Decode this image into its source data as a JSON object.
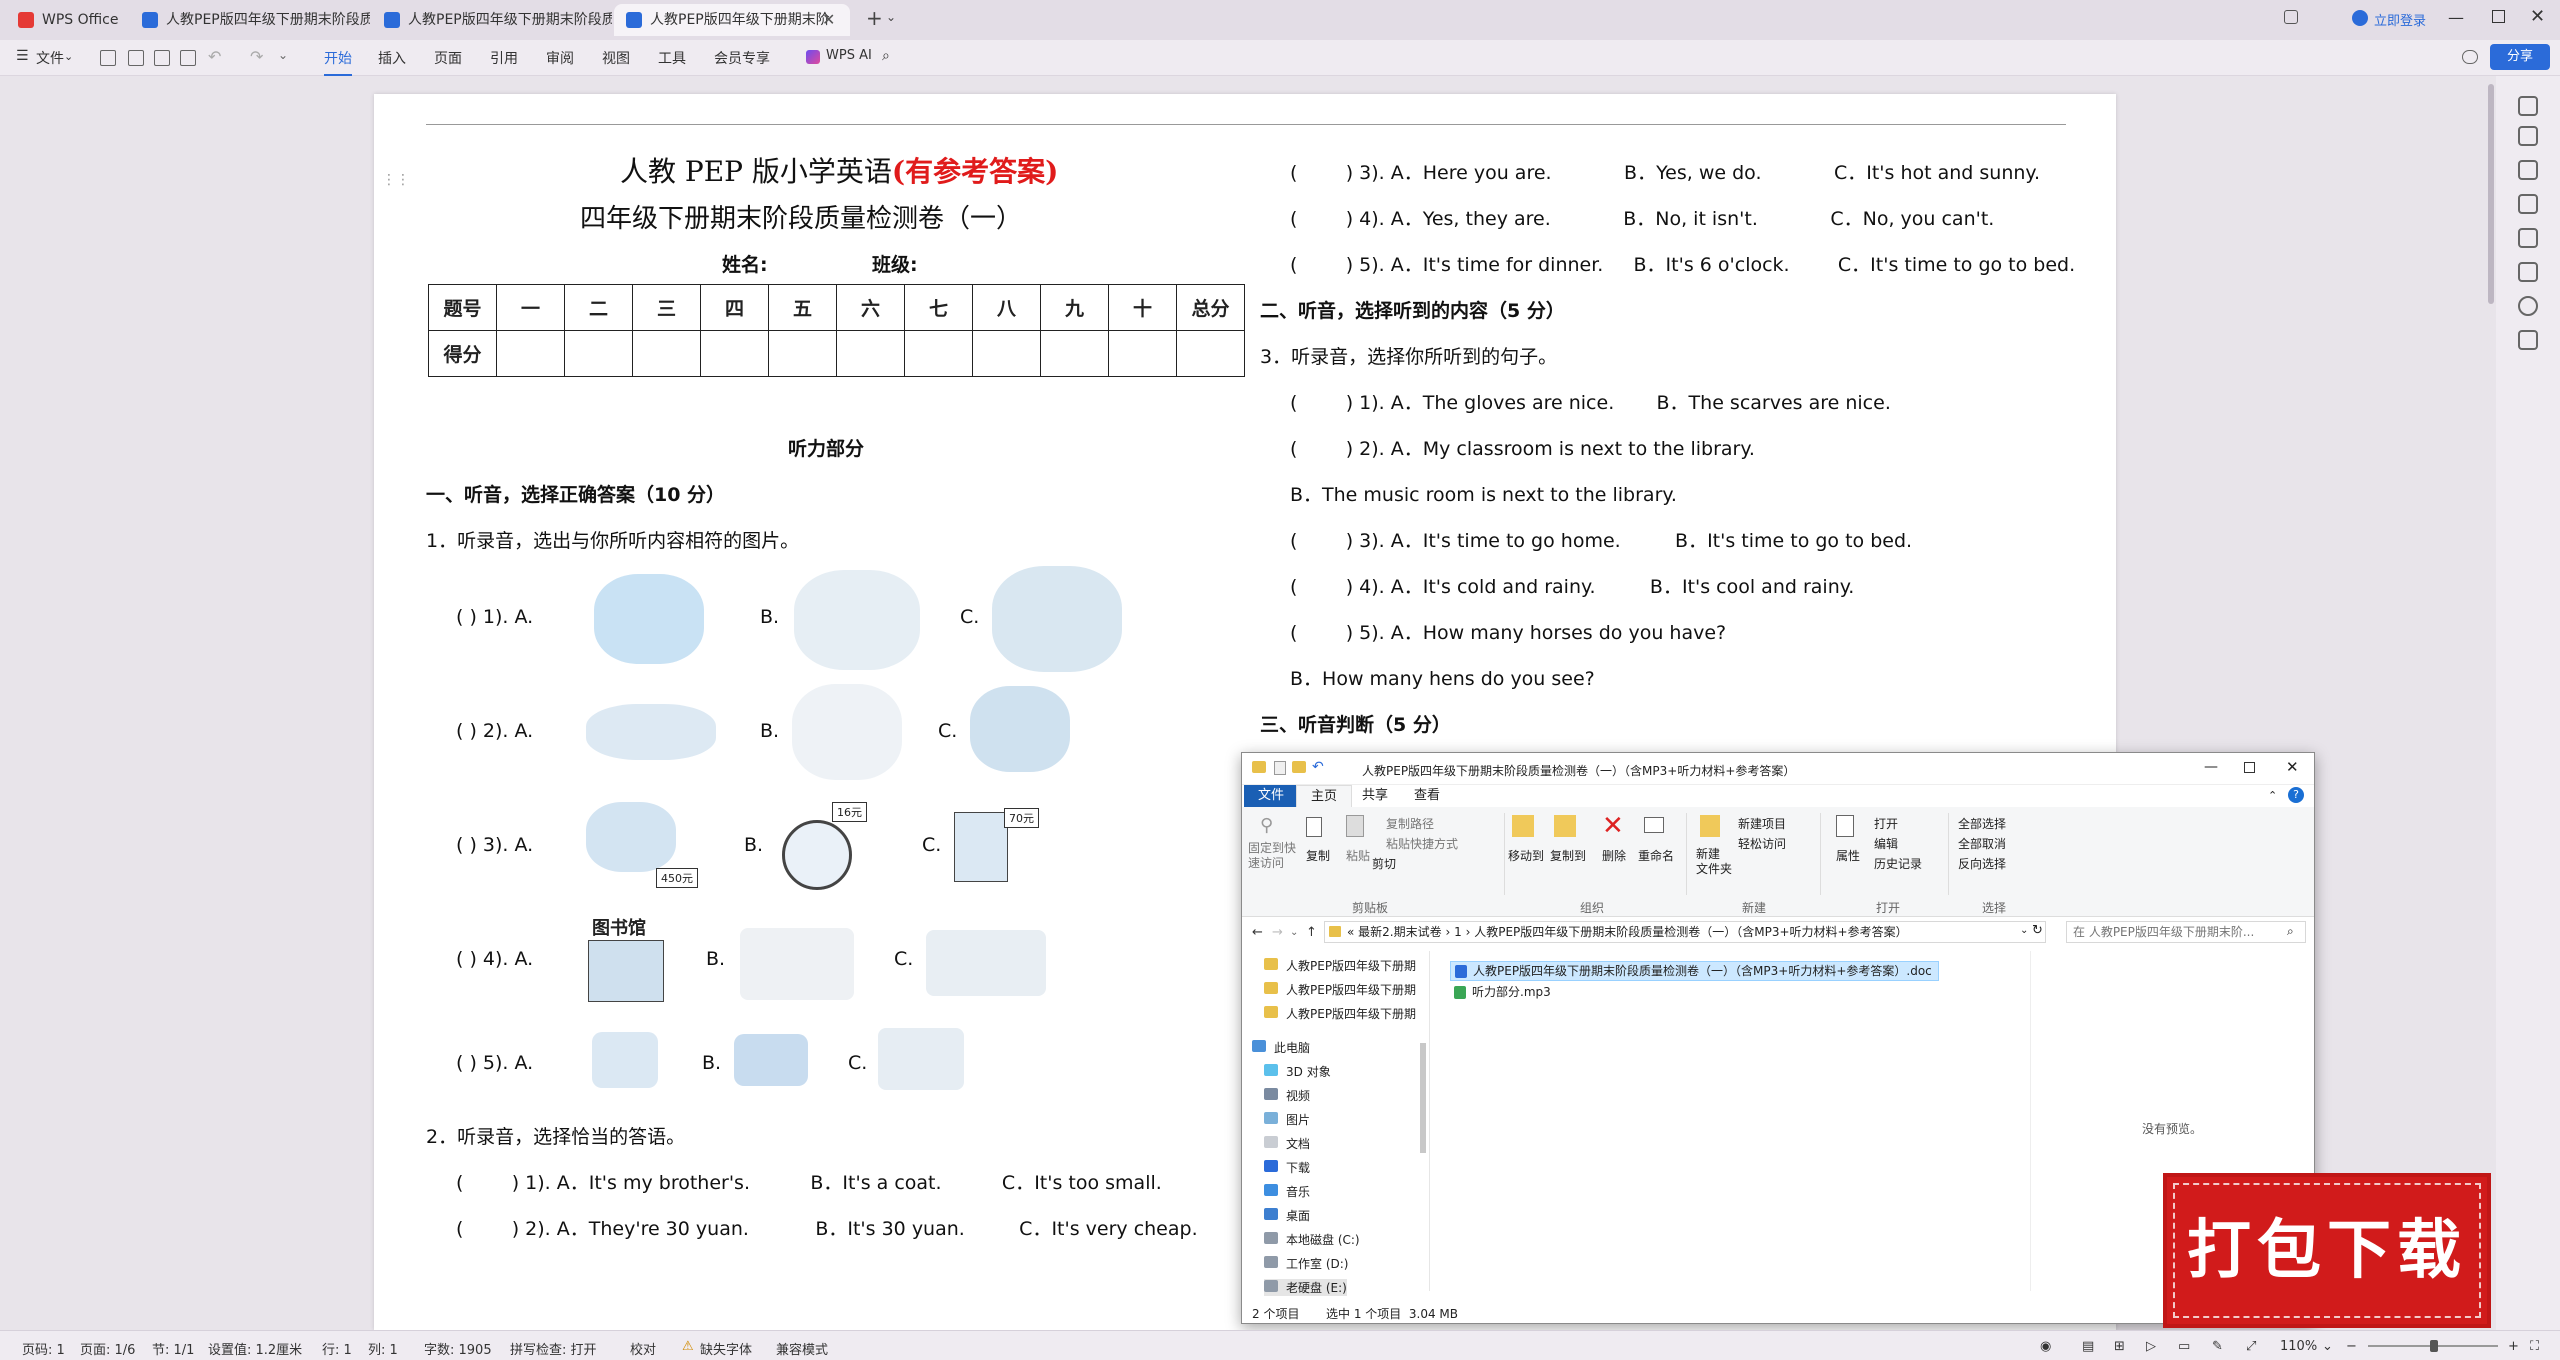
{
  "tabs": {
    "app": "WPS Office",
    "doc1": "人教PEP版四年级下册期末阶段质量检",
    "doc2": "人教PEP版四年级下册期末阶段质量检",
    "doc3": "人教PEP版四年级下册期末阶",
    "login": "立即登录"
  },
  "menu": {
    "file": "文件",
    "items": [
      "开始",
      "插入",
      "页面",
      "引用",
      "审阅",
      "视图",
      "工具",
      "会员专享"
    ],
    "ai": "WPS AI",
    "share": "分享"
  },
  "doc": {
    "title_black": "人教 PEP 版小学英语",
    "title_red": "(有参考答案)",
    "subtitle": "四年级下册期末阶段质量检测卷（一）",
    "name_label": "姓名:",
    "class_label": "班级:",
    "score_headers": [
      "题号",
      "一",
      "二",
      "三",
      "四",
      "五",
      "六",
      "七",
      "八",
      "九",
      "十",
      "总分"
    ],
    "score_row": "得分",
    "section_listen": "听力部分",
    "part1": "一、听音，选择正确答案（10 分）",
    "q1": "1．听录音，选出与你所听内容相符的图片。",
    "pic_rows": [
      {
        "n": "(        ) 1). A.",
        "b": "B.",
        "c": "C."
      },
      {
        "n": "(        ) 2). A.",
        "b": "B.",
        "c": "C."
      },
      {
        "n": "(        ) 3). A.",
        "b": "B.",
        "c": "C."
      },
      {
        "n": "(        ) 4). A.",
        "b": "B.",
        "c": "C."
      },
      {
        "n": "(        ) 5). A.",
        "b": "B.",
        "c": "C."
      }
    ],
    "price1": "450元",
    "price2": "16元",
    "price3": "70元",
    "library": "图书馆",
    "q2": "2．听录音，选择恰当的答语。",
    "q2_items": [
      "(        ) 1). A．It's my brother's.          B．It's a coat.          C．It's too small.",
      "(        ) 2). A．They're 30 yuan.           B．It's 30 yuan.         C．It's very cheap."
    ],
    "right": [
      "(        ) 3). A．Here you are.            B．Yes, we do.            C．It's hot and sunny.",
      "(        ) 4). A．Yes, they are.            B．No, it isn't.            C．No, you can't.",
      "(        ) 5). A．It's time for dinner.     B．It's 6 o'clock.        C．It's time to go to bed."
    ],
    "part2": "二、听音，选择听到的内容（5 分）",
    "q3": "3．听录音，选择你所听到的句子。",
    "q3_items": [
      "(        ) 1). A．The gloves are nice.       B．The scarves are nice.",
      "(        ) 2). A．My classroom is next to the library.",
      "B．The music room is next to the library.",
      "(        ) 3). A．It's time to go home.         B．It's time to go to bed.",
      "(        ) 4). A．It's cold and rainy.         B．It's cool and rainy.",
      "(        ) 5). A．How many horses do you have?",
      "B．How many hens do you see?"
    ],
    "part3": "三、听音判断（5 分）"
  },
  "explorer": {
    "title": "人教PEP版四年级下册期末阶段质量检测卷（一）（含MP3+听力材料+参考答案）",
    "tabs": [
      "文件",
      "主页",
      "共享",
      "查看"
    ],
    "ribbon": {
      "pin": "固定到快\n速访问",
      "copy": "复制",
      "paste": "粘贴",
      "copy_path": "复制路径",
      "paste_shortcut": "粘贴快捷方式",
      "cut": "剪切",
      "move_to": "移动到",
      "copy_to": "复制到",
      "delete": "删除",
      "rename": "重命名",
      "new_folder": "新建\n文件夹",
      "new_item": "新建项目",
      "easy_access": "轻松访问",
      "properties": "属性",
      "open": "打开",
      "edit": "编辑",
      "history": "历史记录",
      "select_all": "全部选择",
      "select_none": "全部取消",
      "invert": "反向选择",
      "groups": [
        "剪贴板",
        "组织",
        "新建",
        "打开",
        "选择"
      ]
    },
    "path": [
      "«",
      "最新2.期末试卷",
      "›",
      "1",
      "›",
      "人教PEP版四年级下册期末阶段质量检测卷（一）（含MP3+听力材料+参考答案）"
    ],
    "search_placeholder": "在 人教PEP版四年级下册期末阶...",
    "nav": [
      "人教PEP版四年级下册期",
      "人教PEP版四年级下册期",
      "人教PEP版四年级下册期",
      "此电脑",
      "3D 对象",
      "视频",
      "图片",
      "文档",
      "下载",
      "音乐",
      "桌面",
      "本地磁盘 (C:)",
      "工作室 (D:)",
      "老硬盘 (E:)"
    ],
    "files": [
      "人教PEP版四年级下册期末阶段质量检测卷（一）（含MP3+听力材料+参考答案）.doc",
      "听力部分.mp3"
    ],
    "no_preview": "没有预览。",
    "status_count": "2 个项目",
    "status_sel": "选中 1 个项目  3.04 MB"
  },
  "status": {
    "page_num": "页码: 1",
    "pages": "页面: 1/6",
    "section": "节: 1/1",
    "setting": "设置值: 1.2厘米",
    "row": "行: 1",
    "col": "列: 1",
    "words": "字数: 1905",
    "spell": "拼写检查: 打开",
    "proof": "校对",
    "missing_font": "缺失字体",
    "compat": "兼容模式",
    "zoom": "110%"
  },
  "watermark": "打包下载"
}
